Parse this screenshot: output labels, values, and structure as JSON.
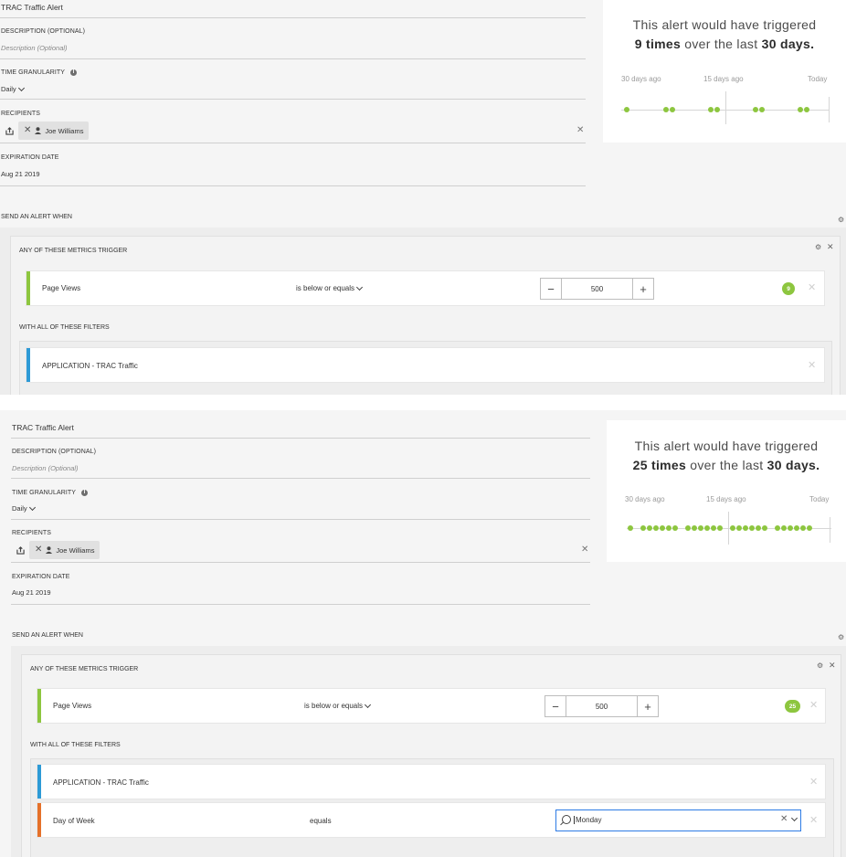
{
  "panels": [
    {
      "alert_name": "TRAC Traffic Alert",
      "description_label": "DESCRIPTION (OPTIONAL)",
      "description_placeholder": "Description (Optional)",
      "time_granularity_label": "TIME GRANULARITY",
      "granularity_value": "Daily",
      "recipients_label": "RECIPIENTS",
      "recipient": "Joe Williams",
      "expiration_label": "EXPIRATION DATE",
      "expiration_value": "Aug 21 2019",
      "summary_line1": "This alert would have triggered",
      "summary_count": "9 times",
      "summary_mid": " over the last ",
      "summary_period": "30 days.",
      "axis_start": "30 days ago",
      "axis_mid": "15 days ago",
      "axis_end": "Today",
      "trigger_count": 9,
      "send_label": "SEND AN ALERT WHEN",
      "metrics_label": "ANY OF THESE METRICS TRIGGER",
      "metric_name": "Page Views",
      "operator": "is below or equals",
      "threshold": "500",
      "badge": "9",
      "filters_label": "WITH ALL OF THESE FILTERS",
      "filter1": "APPLICATION - TRAC Traffic"
    },
    {
      "alert_name": "TRAC Traffic Alert",
      "description_label": "DESCRIPTION (OPTIONAL)",
      "description_placeholder": "Description (Optional)",
      "time_granularity_label": "TIME GRANULARITY",
      "granularity_value": "Daily",
      "recipients_label": "RECIPIENTS",
      "recipient": "Joe Williams",
      "expiration_label": "EXPIRATION DATE",
      "expiration_value": "Aug 21 2019",
      "summary_line1": "This alert would have triggered",
      "summary_count": "25 times",
      "summary_mid": " over the last ",
      "summary_period": "30 days.",
      "axis_start": "30 days ago",
      "axis_mid": "15 days ago",
      "axis_end": "Today",
      "trigger_count": 25,
      "send_label": "SEND AN ALERT WHEN",
      "metrics_label": "ANY OF THESE METRICS TRIGGER",
      "metric_name": "Page Views",
      "operator": "is below or equals",
      "threshold": "500",
      "badge": "25",
      "filters_label": "WITH ALL OF THESE FILTERS",
      "filter1": "APPLICATION - TRAC Traffic",
      "filter2_name": "Day of Week",
      "filter2_operator": "equals",
      "filter2_value": "Monday"
    }
  ],
  "colors": {
    "accent_green": "#8dc63f",
    "metric_bar": "#8dc63f",
    "filter_bar_blue": "#2d9ad6",
    "filter_bar_orange": "#e5712a",
    "focus_blue": "#2d7be5"
  }
}
